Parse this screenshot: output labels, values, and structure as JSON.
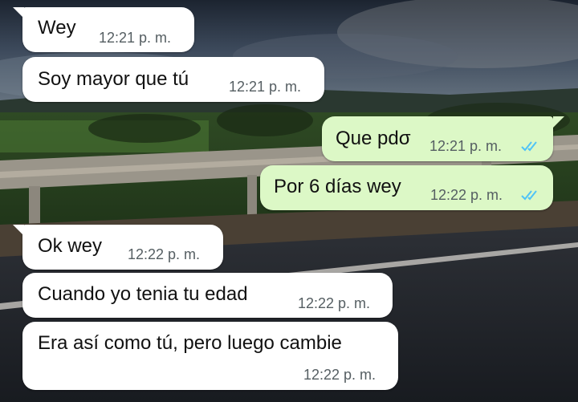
{
  "messages": [
    {
      "direction": "incoming",
      "text": "Wey",
      "time": "12:21 p. m."
    },
    {
      "direction": "incoming",
      "text": "Soy mayor que tú",
      "time": "12:21 p. m."
    },
    {
      "direction": "outgoing",
      "text": "Que pdσ",
      "time": "12:21 p. m.",
      "status": "read",
      "status_icon": "double-check-icon",
      "status_color": "#4fc3f7"
    },
    {
      "direction": "outgoing",
      "text": "Por 6 días wey",
      "time": "12:22 p. m.",
      "status": "read",
      "status_icon": "double-check-icon",
      "status_color": "#4fc3f7"
    },
    {
      "direction": "incoming",
      "text": "Ok wey",
      "time": "12:22 p. m."
    },
    {
      "direction": "incoming",
      "text": "Cuando yo tenia tu edad",
      "time": "12:22 p. m."
    },
    {
      "direction": "incoming",
      "text": "Era así como tú, pero luego cambie",
      "time": "12:22 p. m."
    }
  ],
  "colors": {
    "incoming_bubble": "#ffffff",
    "outgoing_bubble": "#dcf8c6",
    "timestamp": "#555e62",
    "read_ticks": "#4fc3f7"
  },
  "wallpaper": {
    "icon": "landscape-road-photo"
  }
}
